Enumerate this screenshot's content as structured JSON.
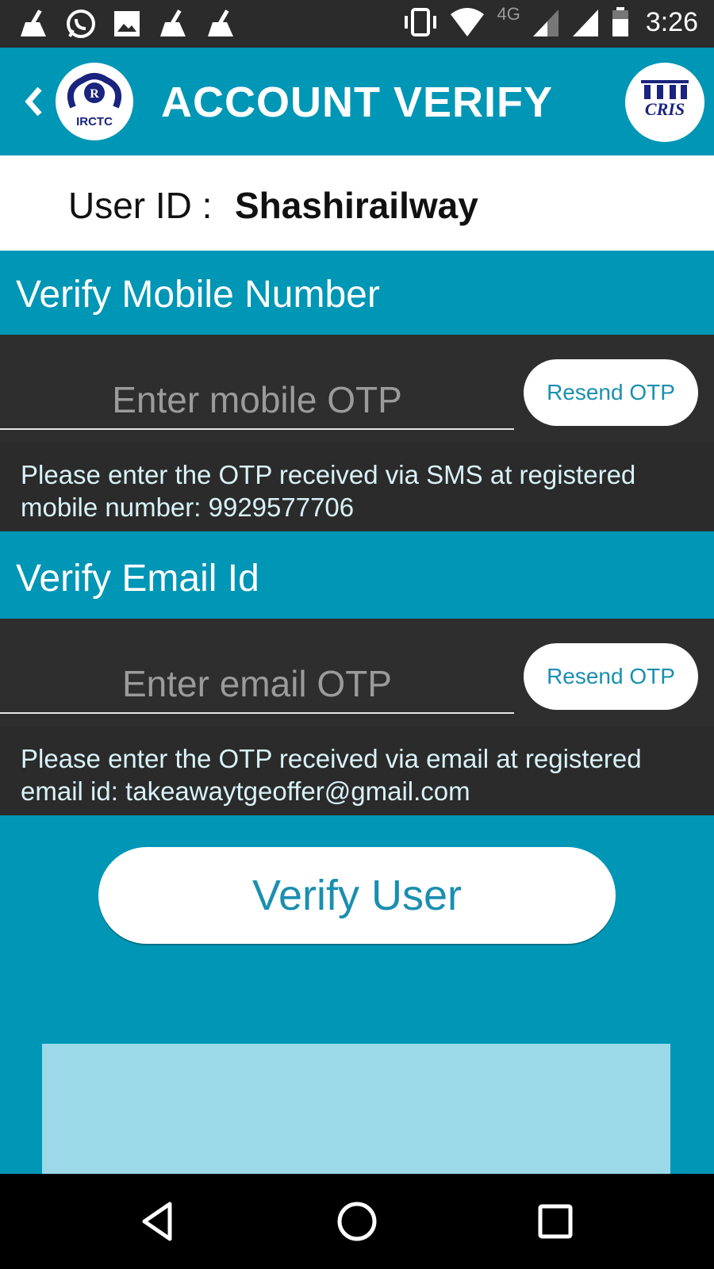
{
  "status_bar": {
    "time": "3:26",
    "network": "4G",
    "left_icons": [
      "cleaner-icon",
      "whatsapp-icon",
      "image-icon",
      "cleaner-icon",
      "cleaner-icon"
    ],
    "right_icons": [
      "vibrate-icon",
      "wifi-icon",
      "signal-icon",
      "signal-icon",
      "battery-icon"
    ]
  },
  "app_bar": {
    "title": "ACCOUNT VERIFY",
    "left_logo_text": "IRCTC",
    "right_logo_text": "CRIS",
    "back_icon": "chevron-left-icon"
  },
  "user": {
    "label": "User ID :",
    "value": "Shashirailway"
  },
  "mobile_section": {
    "title": "Verify Mobile Number",
    "otp_placeholder": "Enter mobile OTP",
    "otp_value": "",
    "resend_label": "Resend OTP",
    "hint": "Please enter the OTP received via SMS at registered mobile number: 9929577706"
  },
  "email_section": {
    "title": "Verify Email Id",
    "otp_placeholder": "Enter email OTP",
    "otp_value": "",
    "resend_label": "Resend OTP",
    "hint": "Please enter the OTP received via email at registered email id: takeawaytgeoffer@gmail.com"
  },
  "actions": {
    "verify_label": "Verify User"
  },
  "colors": {
    "primary": "#0096b5",
    "dark_panel": "#2e2e2e",
    "ad_placeholder": "#9bd8e8"
  },
  "nav_bar": {
    "icons": [
      "back-triangle-icon",
      "home-circle-icon",
      "recents-square-icon"
    ]
  }
}
